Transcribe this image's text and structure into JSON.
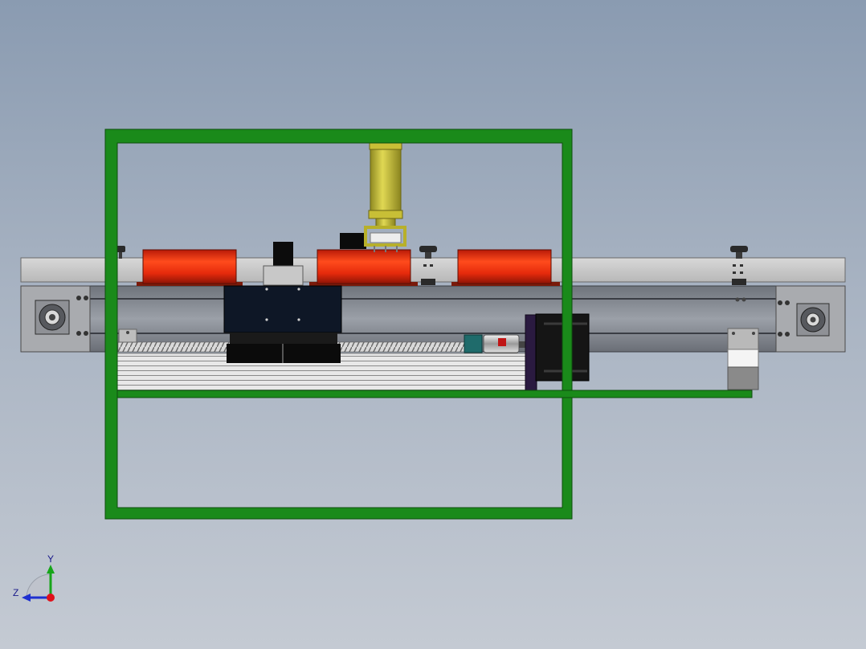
{
  "viewport": {
    "background_top": "#8a9bb1",
    "background_bottom": "#c4cad3"
  },
  "colors": {
    "frame_green": "#1a8a1a",
    "frame_green_edge": "#0d4d0d",
    "rail_gray": "#c9c9c9",
    "profile_gray": "#8d9199",
    "roller_red": "#e8290e",
    "cylinder_yellow": "#c9c23a",
    "motor_black": "#1a1a1a",
    "carriage_navy": "#0f1726",
    "plate_purple": "#3a2a55",
    "coupling_teal": "#1f6b6b"
  },
  "axis_triad": {
    "y_label": "Y",
    "z_label": "Z",
    "y_color": "#17a51a",
    "z_color": "#1e2fd0",
    "origin_color": "#e0101a"
  },
  "icons": [
    "axis-triad-icon"
  ]
}
